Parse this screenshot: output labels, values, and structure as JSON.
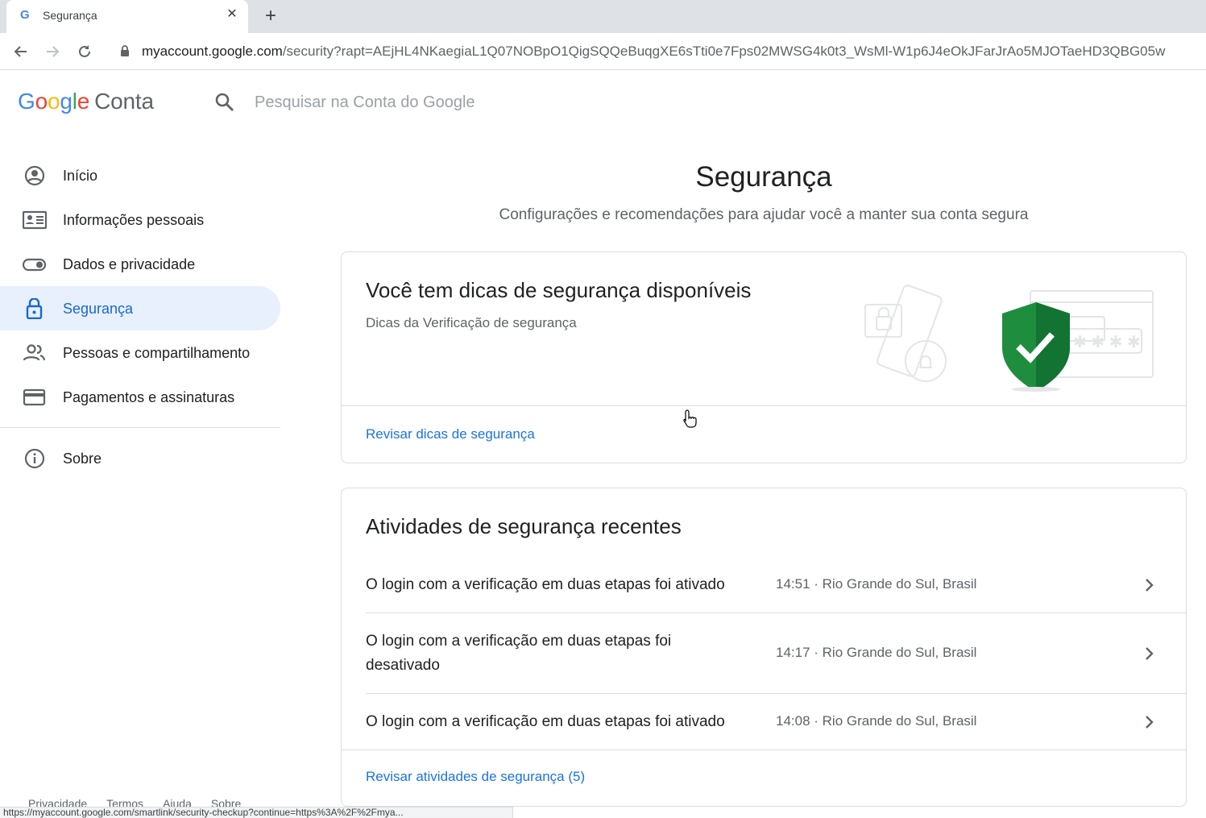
{
  "browser": {
    "tab_title": "Segurança",
    "tab_close": "✕",
    "new_tab": "+",
    "url_host": "myaccount.google.com",
    "url_path": "/security?rapt=AEjHL4NKaegiaL1Q07NOBpO1QigSQQeBuqgXE6sTti0e7Fps02MWSG4k0t3_WsMl-W1p6J4eOkJFarJrAo5MJOTaeHD3QBG05w",
    "status_url": "https://myaccount.google.com/smartlink/security-checkup?continue=https%3A%2F%2Fmya..."
  },
  "header": {
    "logo_G": "G",
    "logo_o1": "o",
    "logo_o2": "o",
    "logo_g": "g",
    "logo_l": "l",
    "logo_e": "e",
    "logo_conta": "Conta",
    "search_placeholder": "Pesquisar na Conta do Google"
  },
  "sidebar": {
    "items": [
      {
        "label": "Início"
      },
      {
        "label": "Informações pessoais"
      },
      {
        "label": "Dados e privacidade"
      },
      {
        "label": "Segurança"
      },
      {
        "label": "Pessoas e compartilhamento"
      },
      {
        "label": "Pagamentos e assinaturas"
      }
    ],
    "about": "Sobre"
  },
  "footer": {
    "links": [
      "Privacidade",
      "Termos",
      "Ajuda",
      "Sobre"
    ]
  },
  "main": {
    "title": "Segurança",
    "subtitle": "Configurações e recomendações para ajudar você a manter sua conta segura",
    "tips_card": {
      "title": "Você tem dicas de segurança disponíveis",
      "subtitle": "Dicas da Verificação de segurança",
      "link": "Revisar dicas de segurança"
    },
    "activity_card": {
      "title": "Atividades de segurança recentes",
      "rows": [
        {
          "desc": "O login com a verificação em duas etapas foi ativado",
          "meta": "14:51 · Rio Grande do Sul, Brasil"
        },
        {
          "desc": "O login com a verificação em duas etapas foi desativado",
          "meta": "14:17 · Rio Grande do Sul, Brasil"
        },
        {
          "desc": "O login com a verificação em duas etapas foi ativado",
          "meta": "14:08 · Rio Grande do Sul, Brasil"
        }
      ],
      "link": "Revisar atividades de segurança (5)"
    }
  },
  "colors": {
    "accent": "#1a73e8",
    "active_bg": "#e8f0fe",
    "shield": "#1e8e3e"
  },
  "icons": {
    "sidebar": [
      "account-circle-icon",
      "id-card-icon",
      "toggle-icon",
      "lock-icon",
      "people-icon",
      "credit-card-icon",
      "info-icon"
    ]
  }
}
